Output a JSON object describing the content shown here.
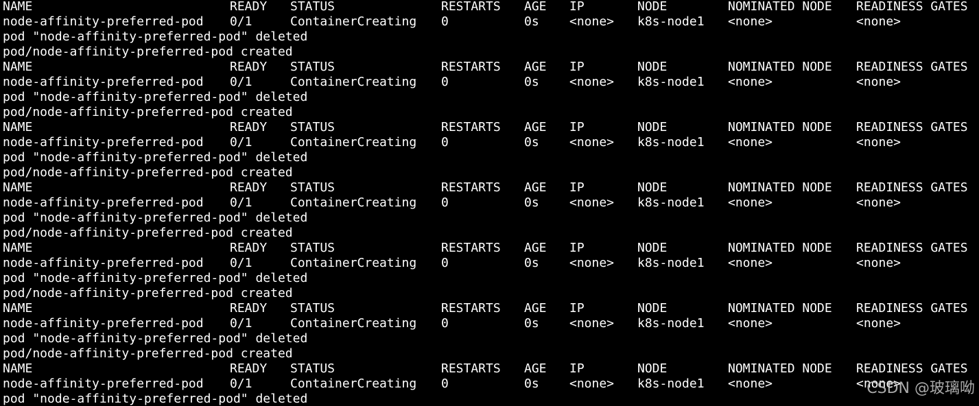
{
  "terminal": {
    "header": {
      "name": "NAME",
      "ready": "READY",
      "status": "STATUS",
      "restarts": "RESTARTS",
      "age": "AGE",
      "ip": "IP",
      "node": "NODE",
      "nominated_node": "NOMINATED NODE",
      "readiness_gates": "READINESS GATES"
    },
    "pod_row": {
      "name": "node-affinity-preferred-pod",
      "ready": "0/1",
      "status": "ContainerCreating",
      "restarts": "0",
      "age": "0s",
      "ip": "<none>",
      "node": "k8s-node1",
      "nominated_node": "<none>",
      "readiness_gates": "<none>"
    },
    "deleted_message": "pod \"node-affinity-preferred-pod\" deleted",
    "created_message": "pod/node-affinity-preferred-pod created"
  },
  "watermark": "CSDN @玻璃呦"
}
